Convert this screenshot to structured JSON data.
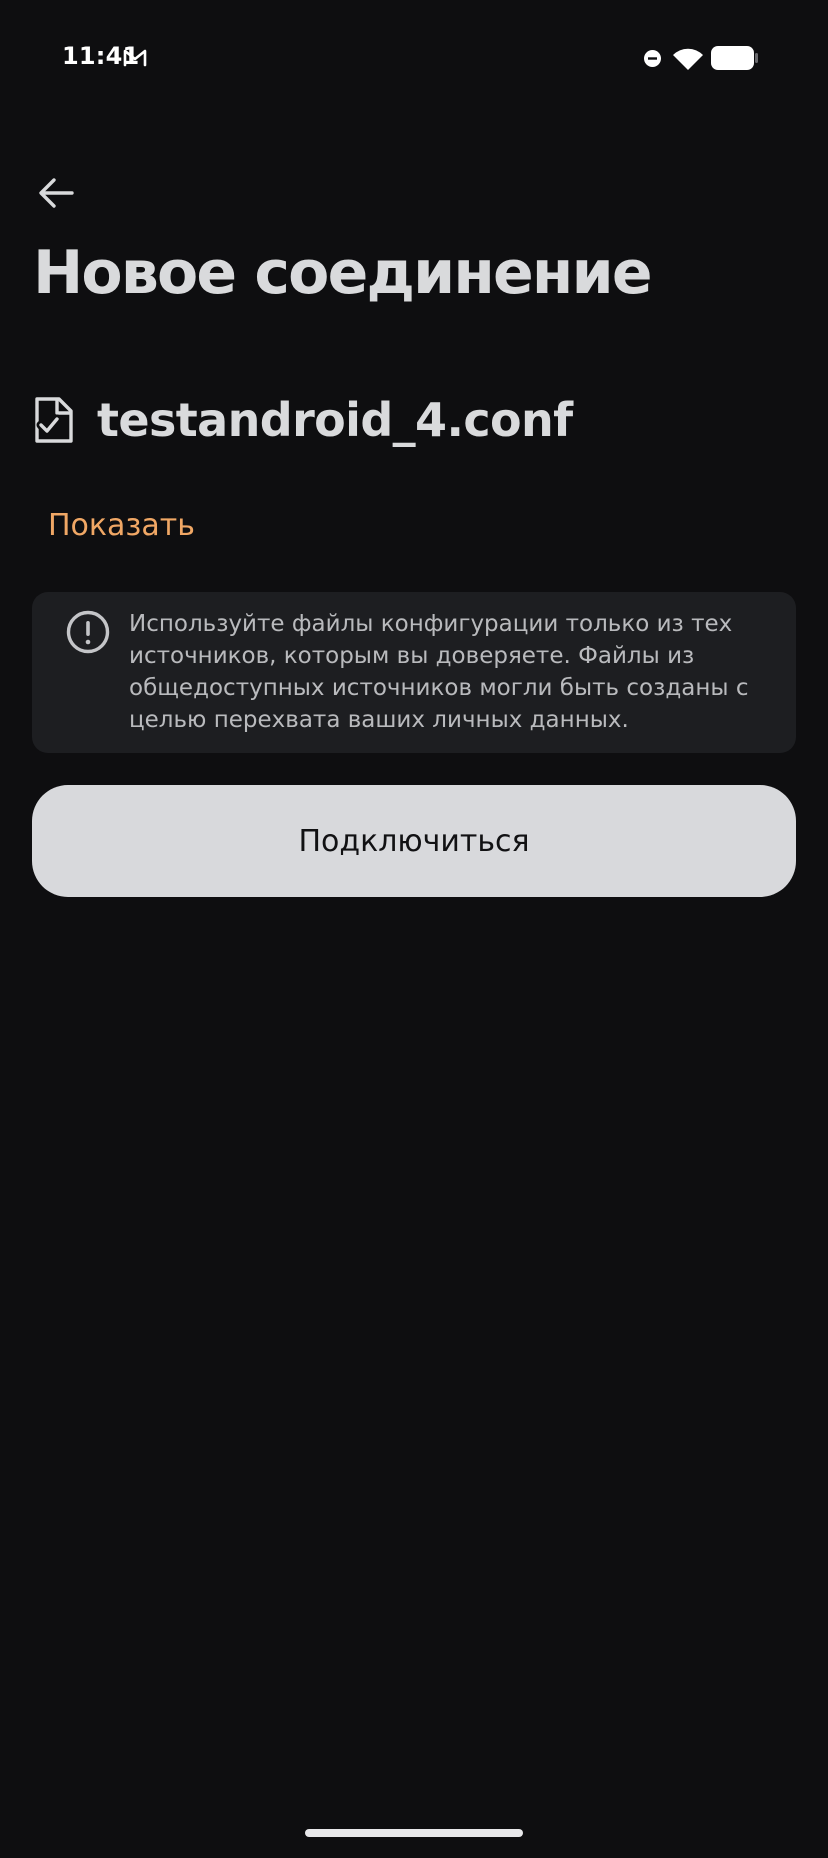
{
  "status_bar": {
    "time": "11:41",
    "icons": [
      "gmail-icon",
      "do-not-disturb-icon",
      "wifi-icon",
      "battery-icon"
    ]
  },
  "header": {
    "back_icon": "arrow-left-icon",
    "title": "Новое соединение"
  },
  "file": {
    "icon": "file-check-icon",
    "name": "testandroid_4.conf"
  },
  "show_link": "Показать",
  "warning": {
    "icon": "alert-circle-icon",
    "text": "Используйте файлы конфигурации только из тех источников, которым вы доверяете. Файлы из общедоступных источников могли быть созданы с целью перехвата ваших личных данных."
  },
  "connect_button": "Подключиться",
  "colors": {
    "background": "#0e0e10",
    "card": "#1d1e21",
    "accent": "#f0a765",
    "button": "#d8d9dc"
  }
}
